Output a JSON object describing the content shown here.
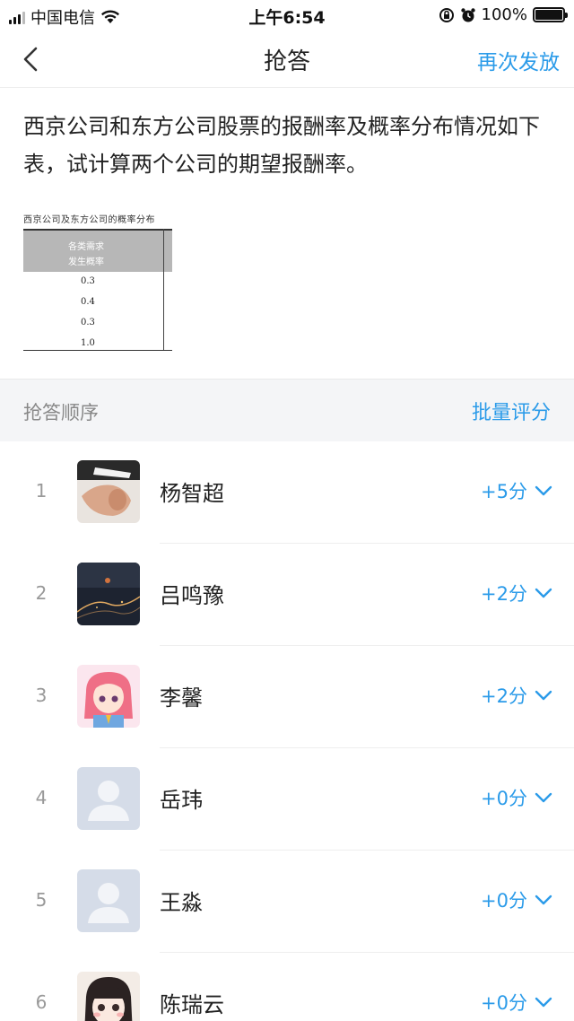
{
  "status_bar": {
    "carrier": "中国电信",
    "time": "上午6:54",
    "battery": "100%"
  },
  "nav": {
    "title": "抢答",
    "action": "再次发放"
  },
  "question": {
    "text": "西京公司和东方公司股票的报酬率及概率分布情况如下表，试计算两个公司的期望报酬率。",
    "table_image": {
      "caption": "西京公司及东方公司的概率分布",
      "header_line1": "各类需求",
      "header_line2": "发生概率",
      "values": [
        "0.3",
        "0.4",
        "0.3",
        "1.0"
      ]
    }
  },
  "section": {
    "title": "抢答顺序",
    "batch_label": "批量评分"
  },
  "answers": [
    {
      "rank": "1",
      "name": "杨智超",
      "score": "+5分"
    },
    {
      "rank": "2",
      "name": "吕鸣豫",
      "score": "+2分"
    },
    {
      "rank": "3",
      "name": "李馨",
      "score": "+2分"
    },
    {
      "rank": "4",
      "name": "岳玮",
      "score": "+0分"
    },
    {
      "rank": "5",
      "name": "王淼",
      "score": "+0分"
    },
    {
      "rank": "6",
      "name": "陈瑞云",
      "score": "+0分"
    }
  ],
  "colors": {
    "accent": "#2b9be9",
    "section_bg": "#f4f5f7"
  }
}
